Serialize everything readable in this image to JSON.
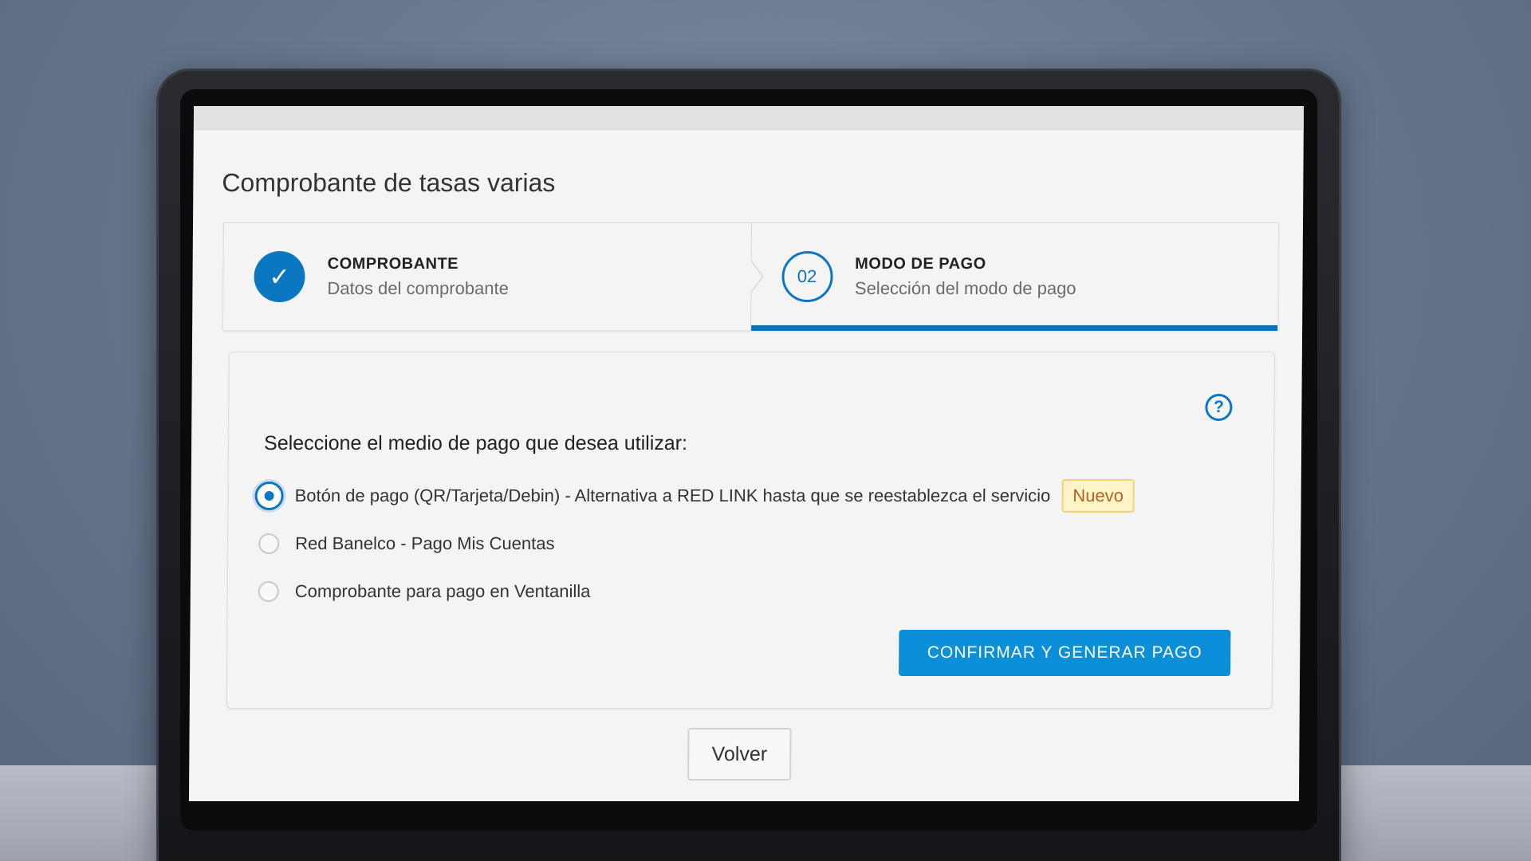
{
  "page": {
    "title": "Comprobante de tasas varias"
  },
  "steps": [
    {
      "title": "COMPROBANTE",
      "subtitle": "Datos del comprobante",
      "status": "completed",
      "icon": "check-icon"
    },
    {
      "number": "02",
      "title": "MODO DE PAGO",
      "subtitle": "Selección del modo de pago",
      "status": "active"
    }
  ],
  "payment": {
    "question": "Seleccione el medio de pago que desea utilizar:",
    "help_icon": "help-icon",
    "options": [
      {
        "label": "Botón de pago (QR/Tarjeta/Debin) - Alternativa a RED LINK hasta que se reestablezca el servicio",
        "badge": "Nuevo",
        "selected": true
      },
      {
        "label": "Red Banelco - Pago Mis Cuentas",
        "selected": false
      },
      {
        "label": "Comprobante para pago en Ventanilla",
        "selected": false
      }
    ],
    "confirm_label": "CONFIRMAR Y GENERAR PAGO"
  },
  "footer": {
    "back_label": "Volver"
  },
  "colors": {
    "primary": "#0b77c2",
    "button": "#0b8fd8",
    "badge_text": "#b5651d",
    "badge_bg": "#fff3c8"
  }
}
